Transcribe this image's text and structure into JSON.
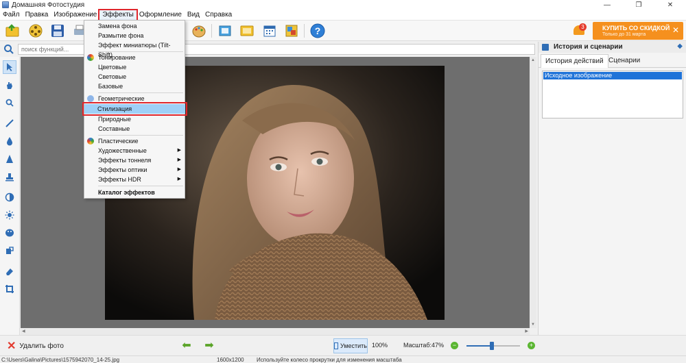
{
  "app": {
    "title": "Домашняя Фотостудия"
  },
  "window_controls": {
    "minimize": "—",
    "maximize": "❐",
    "close": "✕"
  },
  "menubar": {
    "items": [
      {
        "label": "Файл"
      },
      {
        "label": "Правка"
      },
      {
        "label": "Изображение"
      },
      {
        "label": "Эффекты"
      },
      {
        "label": "Оформление"
      },
      {
        "label": "Вид"
      },
      {
        "label": "Справка"
      }
    ]
  },
  "notifications": {
    "count": "3"
  },
  "promo": {
    "title": "КУПИТЬ СО СКИДКОЙ",
    "subtitle": "Только до 31 марта",
    "close": "✕"
  },
  "search": {
    "placeholder": "поиск функций..."
  },
  "effects_menu": {
    "items": [
      {
        "label": "Замена фона"
      },
      {
        "label": "Размытие фона"
      },
      {
        "label": "Эффект миниатюры (Tilt-Shift)"
      },
      {
        "label": "Тонирование"
      },
      {
        "label": "Цветовые"
      },
      {
        "label": "Световые"
      },
      {
        "label": "Базовые"
      },
      {
        "label": "Геометрические"
      },
      {
        "label": "Стилизация"
      },
      {
        "label": "Природные"
      },
      {
        "label": "Составные"
      },
      {
        "label": "Пластические"
      },
      {
        "label": "Художественные"
      },
      {
        "label": "Эффекты тоннеля"
      },
      {
        "label": "Эффекты оптики"
      },
      {
        "label": "Эффекты HDR"
      },
      {
        "label": "Каталог эффектов"
      }
    ]
  },
  "right_panel": {
    "title": "История и сценарии",
    "tabs": [
      {
        "label": "История действий"
      },
      {
        "label": "Сценарии"
      }
    ],
    "history": [
      "Исходное изображение"
    ]
  },
  "bottom": {
    "delete_label": "Удалить фото",
    "fit_label": "Уместить",
    "actual_size": "100%",
    "zoom_label": "Масштаб:",
    "zoom_value": "47%",
    "zoom_fraction": 0.47
  },
  "status": {
    "path": "C:\\Users\\Galina\\Pictures\\1575942070_14-25.jpg",
    "dimensions": "1600x1200",
    "hint": "Используйте колесо прокрутки для изменения масштаба"
  },
  "colors": {
    "accent": "#1f73d8",
    "promo": "#f5901e",
    "highlight_border": "#e0262c"
  }
}
